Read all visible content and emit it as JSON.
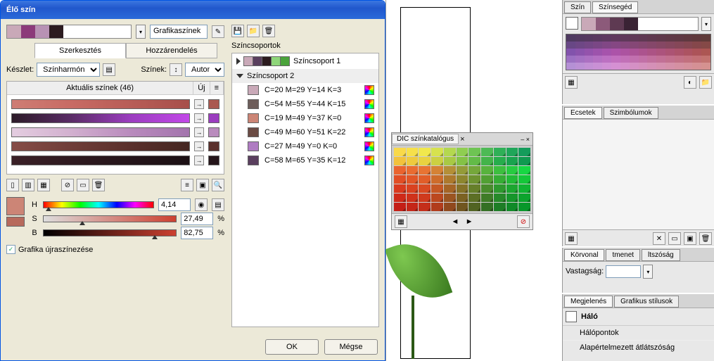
{
  "dialog": {
    "title": "Élő szín",
    "graphic_styles_label": "Grafikaszínek",
    "tabs": {
      "edit": "Szerkesztés",
      "assign": "Hozzárendelés"
    },
    "preset_label": "Készlet:",
    "preset_value": "Színharmónia",
    "colors_label": "Színek:",
    "colors_value": "Autom",
    "current_colors_hdr": "Aktuális színek (46)",
    "new_hdr": "Új",
    "hsb": {
      "H": {
        "label": "H",
        "value": "4,14"
      },
      "S": {
        "label": "S",
        "value": "27,49"
      },
      "B": {
        "label": "B",
        "value": "82,75"
      }
    },
    "pct": "%",
    "recolor_chk": "Grafika újraszínezése",
    "ok": "OK",
    "cancel": "Mégse",
    "groups_label": "Színcsoportok",
    "group1": "Színcsoport 1",
    "group2": "Színcsoport 2",
    "swatches": [
      "C=20 M=29 Y=14 K=3",
      "C=54 M=55 Y=44 K=15",
      "C=19 M=49 Y=37 K=0",
      "C=49 M=60 Y=51 K=22",
      "C=27 M=49 Y=0 K=0",
      "C=58 M=65 Y=35 K=12"
    ],
    "swatch_colors": [
      "#c9a9b8",
      "#6d5d5a",
      "#cc8576",
      "#6b4b44",
      "#af7cc2",
      "#5a3f5e"
    ],
    "top_strip": [
      "#c9a9b8",
      "#8c3a7a",
      "#b892b4",
      "#2c1b1f"
    ],
    "grad_bars": [
      "linear-gradient(90deg,#ce7d74,#c86b64,#b85d57,#a74f4a)",
      "linear-gradient(90deg,#2c1b28,#5a2c66,#9b3dbf,#c248e8)",
      "linear-gradient(90deg,#e4cde0,#d2b0cf,#b98bbd,#a374ad)",
      "linear-gradient(90deg,#864d47,#6f3d38,#5a302c,#452621)",
      "linear-gradient(90deg,#3a2027,#2f1a20,#25151a,#1b1014)"
    ],
    "bar_sw": [
      "#aa5850",
      "#9b3dbf",
      "#b98bbd",
      "#5a302c",
      "#25151a"
    ],
    "group1_strip": [
      "#c9a9b8",
      "#5a3f5e",
      "#2c1b1f",
      "#8fd67a",
      "#4aa33b"
    ]
  },
  "dic": {
    "title": "DIC színkatalógus",
    "grid_colors": [
      "#f9d949",
      "#f6e04a",
      "#f1e84c",
      "#d7e24e",
      "#b4d84f",
      "#8fce51",
      "#6ec453",
      "#4dba55",
      "#2fb057",
      "#1fa659",
      "#149c5b",
      "#f2c23c",
      "#eeca3e",
      "#e9d240",
      "#ccd042",
      "#a8c944",
      "#84c246",
      "#63bb48",
      "#43b44a",
      "#27ad4c",
      "#19a34e",
      "#109950",
      "#ea642f",
      "#e96c31",
      "#e87433",
      "#d58235",
      "#b48f37",
      "#949b39",
      "#75a73b",
      "#58b33d",
      "#3dbf3f",
      "#27cb41",
      "#17d743",
      "#e14e25",
      "#e15627",
      "#e15e29",
      "#ce6c2b",
      "#ad792d",
      "#8d862f",
      "#6e9331",
      "#51a033",
      "#36ad35",
      "#22ba37",
      "#14c739",
      "#d93a1e",
      "#d94220",
      "#d94a22",
      "#c65824",
      "#a56526",
      "#857228",
      "#667f2a",
      "#498c2c",
      "#2e992e",
      "#1ca630",
      "#10b332",
      "#cf2a19",
      "#cf321b",
      "#cf3a1d",
      "#bc481f",
      "#9b5521",
      "#7b6223",
      "#5c6f25",
      "#3f7c27",
      "#268929",
      "#16962b",
      "#0ca32d",
      "#c41e16",
      "#c42618",
      "#c42e1a",
      "#b13c1c",
      "#90491e",
      "#705620",
      "#516322",
      "#347024",
      "#1d7d26",
      "#108a28",
      "#08972a"
    ]
  },
  "panels": {
    "szin": "Szín",
    "szinseged": "Színsegéd",
    "ecsetek": "Ecsetek",
    "szimbolumok": "Szimbólumok",
    "korvonal": "Körvonal",
    "tmenet": "tmenet",
    "tszosag": "ltszóság",
    "vastagsag": "Vastagság:",
    "megjelenes": "Megjelenés",
    "grafikus_stilusok": "Grafikus stílusok",
    "halo": "Háló",
    "halopontok": "Hálópontok",
    "alap": "Alapértelmezett átlátszóság"
  }
}
